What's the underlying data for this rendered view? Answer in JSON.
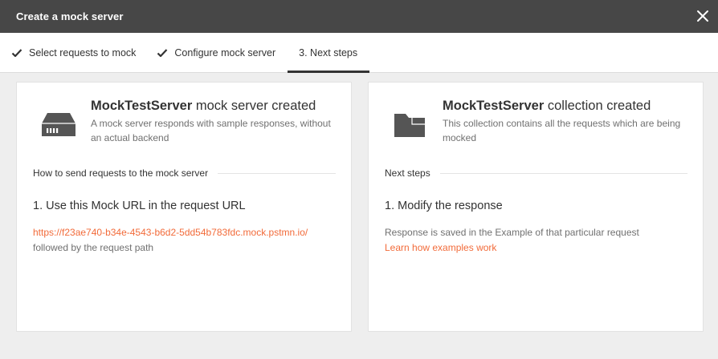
{
  "dialog": {
    "title": "Create a mock server",
    "close_icon": "close-icon"
  },
  "tabs": [
    {
      "label": "Select requests to mock",
      "icon": "checkmark-icon",
      "state": "completed"
    },
    {
      "label": "Configure mock server",
      "icon": "checkmark-icon",
      "state": "completed"
    },
    {
      "label": "3. Next steps",
      "state": "active"
    }
  ],
  "mock_card": {
    "icon": "server-icon",
    "name": "MockTestServer",
    "title_suffix": " mock server created",
    "description": "A mock server responds with sample responses, without an actual backend",
    "section_heading": "How to send requests to the mock server",
    "step_title": "1. Use this Mock URL in the request URL",
    "mock_url": "https://f23ae740-b34e-4543-b6d2-5dd54b783fdc.mock.pstmn.io/",
    "url_suffix": " followed by the request path"
  },
  "collection_card": {
    "icon": "folder-icon",
    "name": "MockTestServer",
    "title_suffix": " collection created",
    "description": "This collection contains all the requests which are being mocked",
    "section_heading": "Next steps",
    "step_title": "1. Modify the response",
    "step_text": "Response is saved in the Example of that particular request",
    "link_text": "Learn how examples work"
  },
  "colors": {
    "titlebar": "#474747",
    "accent_link": "#f26b3a",
    "background": "#eeeeee"
  }
}
